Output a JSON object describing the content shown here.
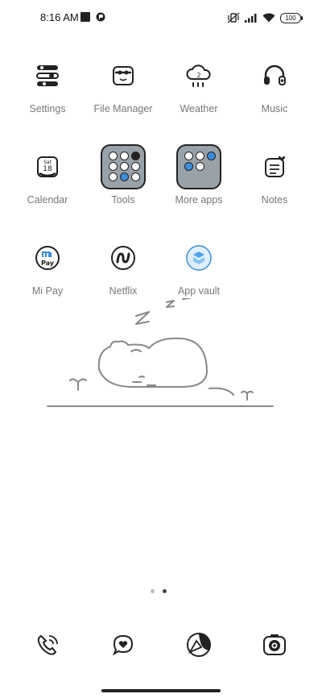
{
  "status_bar": {
    "time": "8:16 AM",
    "battery": "100",
    "icons": [
      "stop-square-icon",
      "notification-icon",
      "vibrate-icon",
      "signal-icon",
      "wifi-icon",
      "battery-icon"
    ]
  },
  "apps": [
    {
      "label": "Settings",
      "icon": "settings-icon"
    },
    {
      "label": "File Manager",
      "icon": "file-manager-icon"
    },
    {
      "label": "Weather",
      "icon": "weather-icon",
      "badge": "2"
    },
    {
      "label": "Music",
      "icon": "headphones-icon"
    },
    {
      "label": "Calendar",
      "icon": "calendar-icon",
      "day": "Sat",
      "date": "18"
    },
    {
      "label": "Tools",
      "icon": "folder-icon"
    },
    {
      "label": "More apps",
      "icon": "folder-icon"
    },
    {
      "label": "Notes",
      "icon": "notes-icon"
    },
    {
      "label": "Mi Pay",
      "icon": "mi-pay-icon",
      "text": "Pay"
    },
    {
      "label": "Netflix",
      "icon": "netflix-icon"
    },
    {
      "label": "App vault",
      "icon": "app-vault-icon"
    }
  ],
  "pagination": {
    "pages": 2,
    "current": 2
  },
  "dock": [
    {
      "icon": "phone-icon"
    },
    {
      "icon": "messages-icon"
    },
    {
      "icon": "browser-icon"
    },
    {
      "icon": "camera-icon"
    }
  ],
  "colors": {
    "background": "#ffffff",
    "label": "#777777",
    "folder": "#9aa2a9"
  }
}
